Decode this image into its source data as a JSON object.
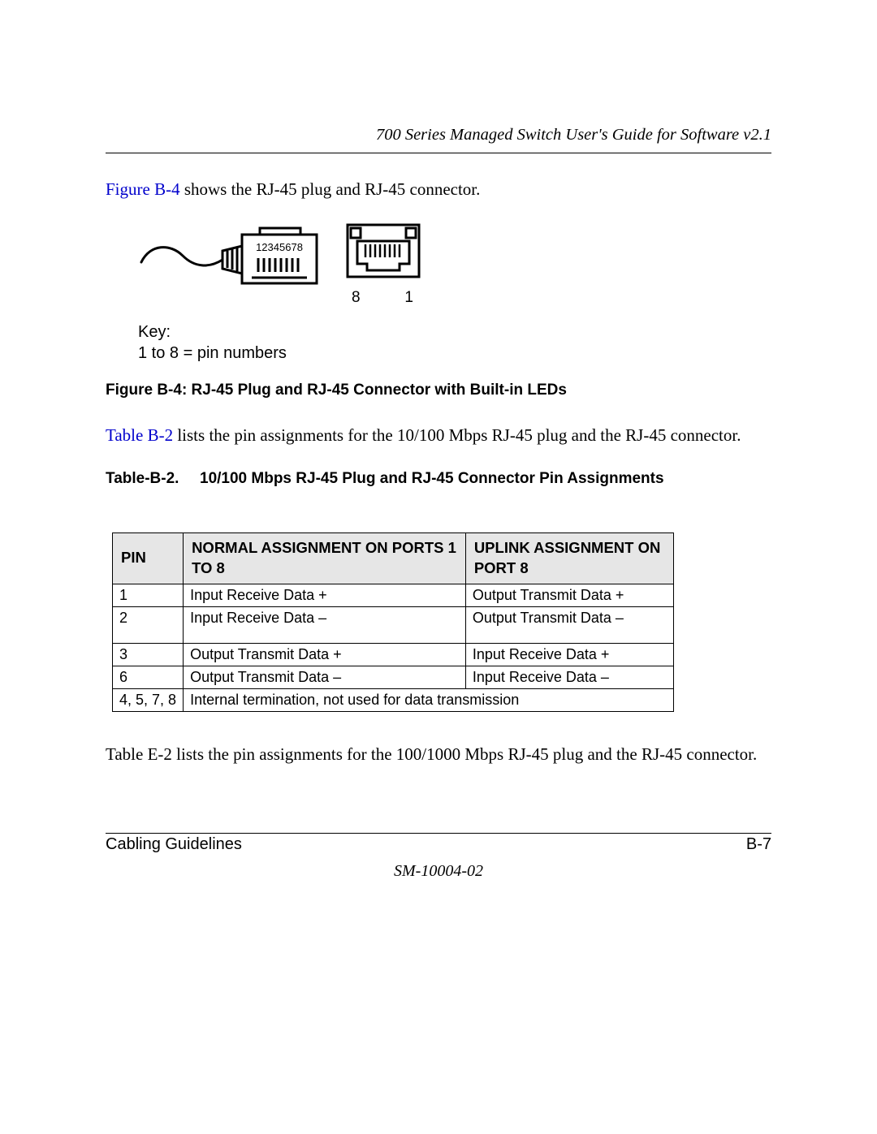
{
  "header": {
    "title": "700 Series Managed Switch User's Guide for Software v2.1"
  },
  "intro": {
    "link": "Figure B-4",
    "rest": " shows the RJ-45 plug and RJ-45 connector."
  },
  "figure": {
    "pin_label": "12345678",
    "connector_left_label": "8",
    "connector_right_label": "1",
    "key_heading": "Key:",
    "key_line": "1 to 8 = pin numbers",
    "caption": "Figure B-4:  RJ-45 Plug and RJ-45 Connector with Built-in LEDs"
  },
  "table_intro": {
    "link": "Table B-2",
    "rest": " lists the pin assignments for the 10/100 Mbps RJ-45 plug and the RJ-45 connector."
  },
  "table_caption": {
    "label": "Table-B-2.",
    "text": "10/100 Mbps RJ-45 Plug and RJ-45 Connector Pin Assignments"
  },
  "table": {
    "headers": {
      "pin": "PIN",
      "normal": "NORMAL ASSIGNMENT ON PORTS 1 TO 8",
      "uplink": "UPLINK ASSIGNMENT ON PORT 8"
    },
    "rows": [
      {
        "pin": "1",
        "normal": "Input Receive Data +",
        "uplink": "Output Transmit Data +"
      },
      {
        "pin": "2",
        "normal": "Input Receive Data –",
        "uplink": "Output Transmit Data –"
      },
      {
        "pin": "3",
        "normal": "Output Transmit Data +",
        "uplink": "Input Receive Data +"
      },
      {
        "pin": "6",
        "normal": "Output Transmit Data –",
        "uplink": "Input Receive Data –"
      }
    ],
    "footer_row": {
      "pin": "4, 5, 7, 8",
      "text": "Internal termination, not used for data transmission"
    }
  },
  "closing_para": "Table E-2 lists the pin assignments for the 100/1000 Mbps RJ-45 plug and the RJ-45 connector.",
  "footer": {
    "left": "Cabling Guidelines",
    "right": "B-7",
    "doc_id": "SM-10004-02"
  }
}
